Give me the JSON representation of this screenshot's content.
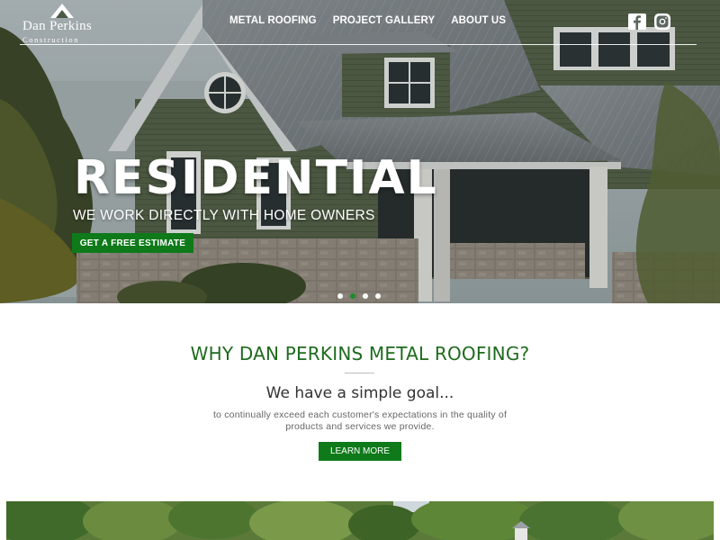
{
  "logo": {
    "name": "Dan Perkins",
    "subtitle": "Construction",
    "icon": "roof-peak-icon"
  },
  "nav": {
    "items": [
      {
        "label": "METAL ROOFING"
      },
      {
        "label": "PROJECT GALLERY"
      },
      {
        "label": "ABOUT US"
      }
    ]
  },
  "social": {
    "facebook_icon": "facebook-icon",
    "instagram_icon": "instagram-icon"
  },
  "hero": {
    "title": "RESIDENTIAL",
    "subtitle": "WE WORK DIRECTLY WITH HOME OWNERS",
    "cta_label": "GET A FREE ESTIMATE",
    "slides_count": 4,
    "active_slide": 2
  },
  "why": {
    "title": "WHY DAN PERKINS METAL ROOFING?",
    "goal": "We have a simple goal...",
    "body_line1": "to continually exceed each customer's expectations in the quality of",
    "body_line2": "products and services we provide.",
    "button_label": "LEARN MORE"
  },
  "colors": {
    "accent_green": "#0e7a1a",
    "heading_green": "#1e6b1e"
  }
}
